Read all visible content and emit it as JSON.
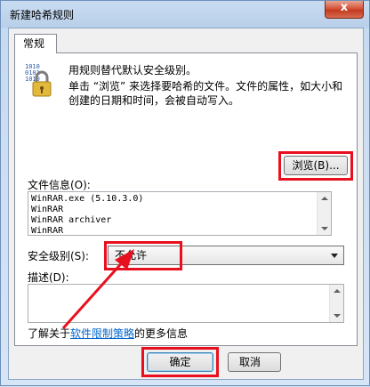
{
  "window": {
    "title": "新建哈希规则",
    "close_glyph": "x"
  },
  "tab": {
    "label": "常规"
  },
  "description": {
    "line1": "用规则替代默认安全级别。",
    "line2": "单击 “浏览” 来选择要哈希的文件。文件的属性，如大小和创建的日期和时间，会被自动写入。"
  },
  "browse_button": {
    "label": "浏览(B)..."
  },
  "file_info": {
    "label": "文件信息(O):",
    "lines": [
      "WinRAR.exe (5.10.3.0)",
      "WinRAR",
      "WinRAR archiver",
      "WinRAR"
    ]
  },
  "security_level": {
    "label": "安全级别(S):",
    "selected": "不允许"
  },
  "description_field": {
    "label": "描述(D):",
    "value": ""
  },
  "info_link": {
    "prefix": "了解关于",
    "link": "软件限制策略",
    "suffix": "的更多信息"
  },
  "buttons": {
    "ok": "确定",
    "cancel": "取消"
  },
  "annotation": {
    "highlight_color": "#e8101f"
  },
  "icons": {
    "lock": "lock-binary-icon"
  }
}
